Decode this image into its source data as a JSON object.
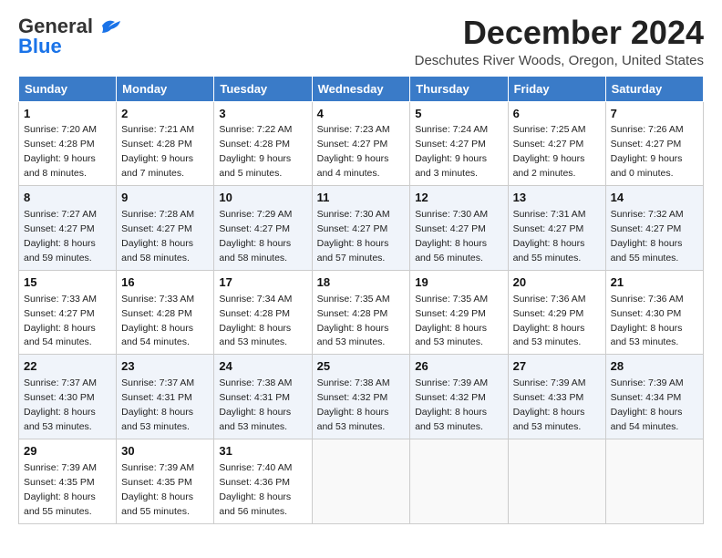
{
  "header": {
    "logo_general": "General",
    "logo_blue": "Blue",
    "title": "December 2024",
    "subtitle": "Deschutes River Woods, Oregon, United States"
  },
  "weekdays": [
    "Sunday",
    "Monday",
    "Tuesday",
    "Wednesday",
    "Thursday",
    "Friday",
    "Saturday"
  ],
  "weeks": [
    [
      {
        "day": "1",
        "sunrise": "Sunrise: 7:20 AM",
        "sunset": "Sunset: 4:28 PM",
        "daylight": "Daylight: 9 hours and 8 minutes."
      },
      {
        "day": "2",
        "sunrise": "Sunrise: 7:21 AM",
        "sunset": "Sunset: 4:28 PM",
        "daylight": "Daylight: 9 hours and 7 minutes."
      },
      {
        "day": "3",
        "sunrise": "Sunrise: 7:22 AM",
        "sunset": "Sunset: 4:28 PM",
        "daylight": "Daylight: 9 hours and 5 minutes."
      },
      {
        "day": "4",
        "sunrise": "Sunrise: 7:23 AM",
        "sunset": "Sunset: 4:27 PM",
        "daylight": "Daylight: 9 hours and 4 minutes."
      },
      {
        "day": "5",
        "sunrise": "Sunrise: 7:24 AM",
        "sunset": "Sunset: 4:27 PM",
        "daylight": "Daylight: 9 hours and 3 minutes."
      },
      {
        "day": "6",
        "sunrise": "Sunrise: 7:25 AM",
        "sunset": "Sunset: 4:27 PM",
        "daylight": "Daylight: 9 hours and 2 minutes."
      },
      {
        "day": "7",
        "sunrise": "Sunrise: 7:26 AM",
        "sunset": "Sunset: 4:27 PM",
        "daylight": "Daylight: 9 hours and 0 minutes."
      }
    ],
    [
      {
        "day": "8",
        "sunrise": "Sunrise: 7:27 AM",
        "sunset": "Sunset: 4:27 PM",
        "daylight": "Daylight: 8 hours and 59 minutes."
      },
      {
        "day": "9",
        "sunrise": "Sunrise: 7:28 AM",
        "sunset": "Sunset: 4:27 PM",
        "daylight": "Daylight: 8 hours and 58 minutes."
      },
      {
        "day": "10",
        "sunrise": "Sunrise: 7:29 AM",
        "sunset": "Sunset: 4:27 PM",
        "daylight": "Daylight: 8 hours and 58 minutes."
      },
      {
        "day": "11",
        "sunrise": "Sunrise: 7:30 AM",
        "sunset": "Sunset: 4:27 PM",
        "daylight": "Daylight: 8 hours and 57 minutes."
      },
      {
        "day": "12",
        "sunrise": "Sunrise: 7:30 AM",
        "sunset": "Sunset: 4:27 PM",
        "daylight": "Daylight: 8 hours and 56 minutes."
      },
      {
        "day": "13",
        "sunrise": "Sunrise: 7:31 AM",
        "sunset": "Sunset: 4:27 PM",
        "daylight": "Daylight: 8 hours and 55 minutes."
      },
      {
        "day": "14",
        "sunrise": "Sunrise: 7:32 AM",
        "sunset": "Sunset: 4:27 PM",
        "daylight": "Daylight: 8 hours and 55 minutes."
      }
    ],
    [
      {
        "day": "15",
        "sunrise": "Sunrise: 7:33 AM",
        "sunset": "Sunset: 4:27 PM",
        "daylight": "Daylight: 8 hours and 54 minutes."
      },
      {
        "day": "16",
        "sunrise": "Sunrise: 7:33 AM",
        "sunset": "Sunset: 4:28 PM",
        "daylight": "Daylight: 8 hours and 54 minutes."
      },
      {
        "day": "17",
        "sunrise": "Sunrise: 7:34 AM",
        "sunset": "Sunset: 4:28 PM",
        "daylight": "Daylight: 8 hours and 53 minutes."
      },
      {
        "day": "18",
        "sunrise": "Sunrise: 7:35 AM",
        "sunset": "Sunset: 4:28 PM",
        "daylight": "Daylight: 8 hours and 53 minutes."
      },
      {
        "day": "19",
        "sunrise": "Sunrise: 7:35 AM",
        "sunset": "Sunset: 4:29 PM",
        "daylight": "Daylight: 8 hours and 53 minutes."
      },
      {
        "day": "20",
        "sunrise": "Sunrise: 7:36 AM",
        "sunset": "Sunset: 4:29 PM",
        "daylight": "Daylight: 8 hours and 53 minutes."
      },
      {
        "day": "21",
        "sunrise": "Sunrise: 7:36 AM",
        "sunset": "Sunset: 4:30 PM",
        "daylight": "Daylight: 8 hours and 53 minutes."
      }
    ],
    [
      {
        "day": "22",
        "sunrise": "Sunrise: 7:37 AM",
        "sunset": "Sunset: 4:30 PM",
        "daylight": "Daylight: 8 hours and 53 minutes."
      },
      {
        "day": "23",
        "sunrise": "Sunrise: 7:37 AM",
        "sunset": "Sunset: 4:31 PM",
        "daylight": "Daylight: 8 hours and 53 minutes."
      },
      {
        "day": "24",
        "sunrise": "Sunrise: 7:38 AM",
        "sunset": "Sunset: 4:31 PM",
        "daylight": "Daylight: 8 hours and 53 minutes."
      },
      {
        "day": "25",
        "sunrise": "Sunrise: 7:38 AM",
        "sunset": "Sunset: 4:32 PM",
        "daylight": "Daylight: 8 hours and 53 minutes."
      },
      {
        "day": "26",
        "sunrise": "Sunrise: 7:39 AM",
        "sunset": "Sunset: 4:32 PM",
        "daylight": "Daylight: 8 hours and 53 minutes."
      },
      {
        "day": "27",
        "sunrise": "Sunrise: 7:39 AM",
        "sunset": "Sunset: 4:33 PM",
        "daylight": "Daylight: 8 hours and 53 minutes."
      },
      {
        "day": "28",
        "sunrise": "Sunrise: 7:39 AM",
        "sunset": "Sunset: 4:34 PM",
        "daylight": "Daylight: 8 hours and 54 minutes."
      }
    ],
    [
      {
        "day": "29",
        "sunrise": "Sunrise: 7:39 AM",
        "sunset": "Sunset: 4:35 PM",
        "daylight": "Daylight: 8 hours and 55 minutes."
      },
      {
        "day": "30",
        "sunrise": "Sunrise: 7:39 AM",
        "sunset": "Sunset: 4:35 PM",
        "daylight": "Daylight: 8 hours and 55 minutes."
      },
      {
        "day": "31",
        "sunrise": "Sunrise: 7:40 AM",
        "sunset": "Sunset: 4:36 PM",
        "daylight": "Daylight: 8 hours and 56 minutes."
      },
      null,
      null,
      null,
      null
    ]
  ]
}
